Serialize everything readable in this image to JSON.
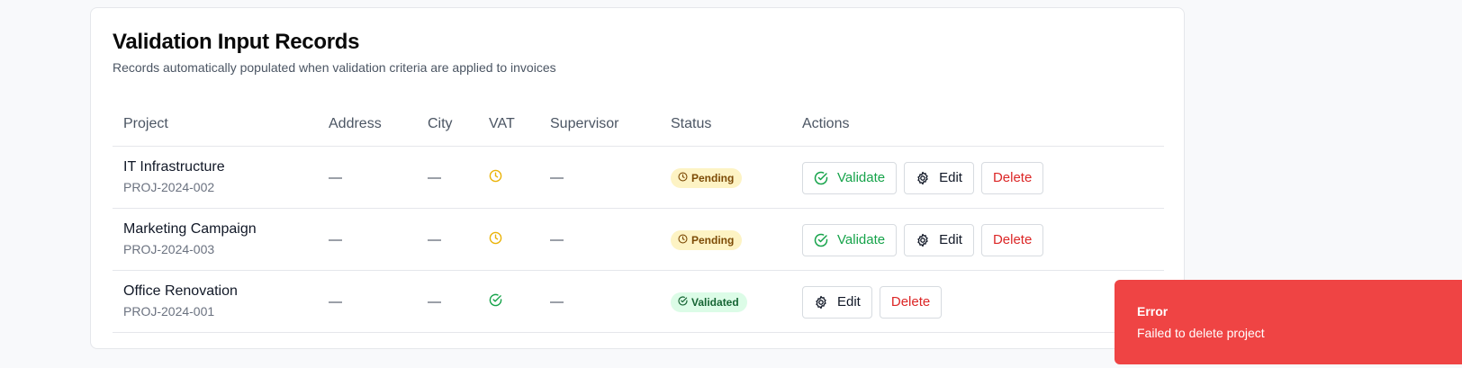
{
  "card": {
    "title": "Validation Input Records",
    "subtitle": "Records automatically populated when validation criteria are applied to invoices"
  },
  "table": {
    "headers": [
      "Project",
      "Address",
      "City",
      "VAT",
      "Supervisor",
      "Status",
      "Actions"
    ],
    "rows": [
      {
        "name": "IT Infrastructure",
        "code": "PROJ-2024-002",
        "address": "—",
        "city": "—",
        "vat_icon": "clock-icon",
        "supervisor": "—",
        "status": "Pending",
        "status_icon": "clock-icon",
        "actions": {
          "validate": "Validate",
          "edit": "Edit",
          "delete": "Delete"
        }
      },
      {
        "name": "Marketing Campaign",
        "code": "PROJ-2024-003",
        "address": "—",
        "city": "—",
        "vat_icon": "clock-icon",
        "supervisor": "—",
        "status": "Pending",
        "status_icon": "clock-icon",
        "actions": {
          "validate": "Validate",
          "edit": "Edit",
          "delete": "Delete"
        }
      },
      {
        "name": "Office Renovation",
        "code": "PROJ-2024-001",
        "address": "—",
        "city": "—",
        "vat_icon": "check-circle-icon",
        "supervisor": "—",
        "status": "Validated",
        "status_icon": "check-circle-icon",
        "actions": {
          "edit": "Edit",
          "delete": "Delete"
        }
      }
    ]
  },
  "toast": {
    "title": "Error",
    "message": "Failed to delete project"
  },
  "colors": {
    "pending_icon": "#eab308",
    "validated_icon": "#16a34a",
    "validate_text": "#16a34a",
    "delete_text": "#dc2626",
    "toast_bg": "#ef4444"
  }
}
